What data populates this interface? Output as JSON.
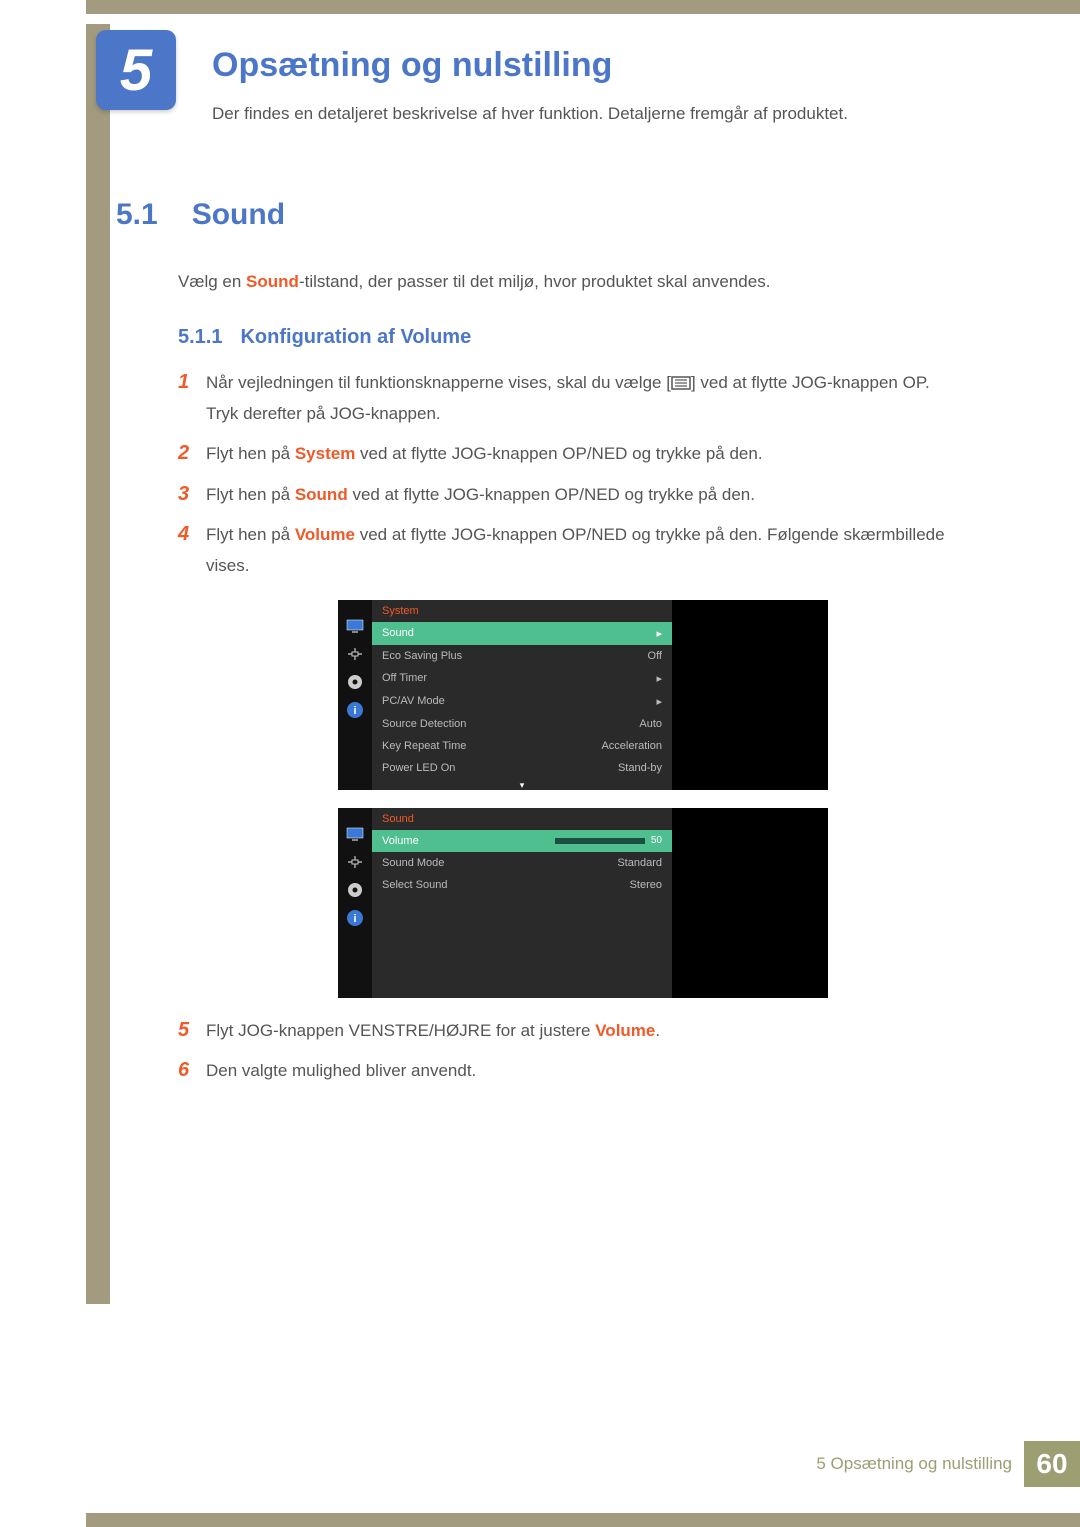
{
  "chapter": {
    "number": "5",
    "title": "Opsætning og nulstilling",
    "subtitle": "Der findes en detaljeret beskrivelse af hver funktion. Detaljerne fremgår af produktet."
  },
  "section": {
    "number": "5.1",
    "title": "Sound",
    "intro_pre": "Vælg en ",
    "intro_bold": "Sound",
    "intro_post": "-tilstand, der passer til det miljø, hvor produktet skal anvendes."
  },
  "subsection": {
    "number": "5.1.1",
    "title": "Konfiguration af Volume"
  },
  "steps": {
    "s1_pre": "Når vejledningen til funktionsknapperne vises, skal du vælge [",
    "s1_post": "] ved at flytte JOG-knappen OP. Tryk derefter på JOG-knappen.",
    "s2_pre": "Flyt hen på ",
    "s2_bold": "System",
    "s2_post": " ved at flytte JOG-knappen OP/NED og trykke på den.",
    "s3_pre": "Flyt hen på ",
    "s3_bold": "Sound",
    "s3_post": " ved at flytte JOG-knappen OP/NED og trykke på den.",
    "s4_pre": "Flyt hen på ",
    "s4_bold": "Volume",
    "s4_post": " ved at flytte JOG-knappen OP/NED og trykke på den. Følgende skærmbillede vises.",
    "s5_pre": "Flyt JOG-knappen VENSTRE/HØJRE for at justere ",
    "s5_bold": "Volume",
    "s5_post": ".",
    "s6": "Den valgte mulighed bliver anvendt.",
    "n1": "1",
    "n2": "2",
    "n3": "3",
    "n4": "4",
    "n5": "5",
    "n6": "6"
  },
  "osd1": {
    "header": "System",
    "sel_label": "Sound",
    "sel_val": "▸",
    "rows": [
      {
        "label": "Eco Saving Plus",
        "value": "Off"
      },
      {
        "label": "Off Timer",
        "value": "▸"
      },
      {
        "label": "PC/AV Mode",
        "value": "▸"
      },
      {
        "label": "Source Detection",
        "value": "Auto"
      },
      {
        "label": "Key Repeat Time",
        "value": "Acceleration"
      },
      {
        "label": "Power LED On",
        "value": "Stand-by"
      }
    ],
    "scroll": "▾"
  },
  "osd2": {
    "header": "Sound",
    "sel_label": "Volume",
    "sel_val": "50",
    "slider_pct": "50%",
    "rows": [
      {
        "label": "Sound Mode",
        "value": "Standard"
      },
      {
        "label": "Select Sound",
        "value": "Stereo"
      }
    ]
  },
  "footer": {
    "text": "5 Opsætning og nulstilling",
    "page": "60"
  }
}
